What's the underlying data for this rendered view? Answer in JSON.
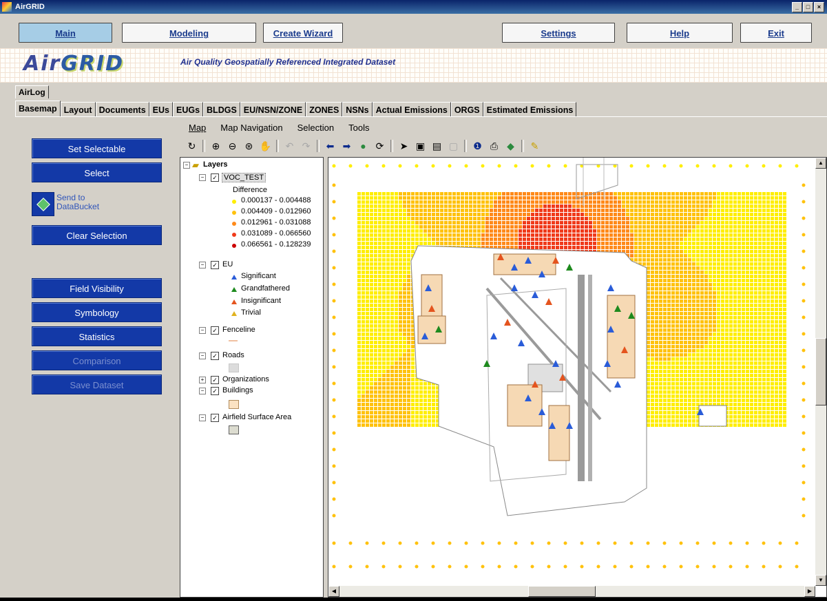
{
  "window": {
    "title": "AirGRID",
    "controls": [
      "_",
      "□",
      "×"
    ]
  },
  "nav": {
    "main": "Main",
    "modeling": "Modeling",
    "create_wizard": "Create Wizard",
    "settings": "Settings",
    "help": "Help",
    "exit": "Exit"
  },
  "banner": {
    "logo_part1": "Air",
    "logo_part2": "GRID",
    "subtitle": "Air Quality Geospatially Referenced Integrated Dataset"
  },
  "airlog_tab": "AirLog",
  "tabs": [
    "Basemap",
    "Layout",
    "Documents",
    "EUs",
    "EUGs",
    "BLDGS",
    "EU/NSN/ZONE",
    "ZONES",
    "NSNs",
    "Actual Emissions",
    "ORGS",
    "Estimated Emissions"
  ],
  "menu": {
    "map": "Map",
    "map_navigation": "Map Navigation",
    "selection": "Selection",
    "tools": "Tools"
  },
  "toolbar_icons": [
    "refresh-icon",
    "zoom-in-icon",
    "zoom-out-icon",
    "zoom-full-icon",
    "pan-icon",
    "back-icon",
    "forward-icon",
    "left-arrow-icon",
    "right-arrow-icon",
    "globe-icon",
    "reload-icon",
    "select-arrow-icon",
    "identify-icon",
    "layer-icon",
    "table-icon",
    "info-icon",
    "print-icon",
    "symbol-icon",
    "measure-icon"
  ],
  "left_buttons": {
    "set_selectable": "Set Selectable",
    "select": "Select",
    "send_to": "Send to",
    "databucket": "DataBucket",
    "clear_selection": "Clear Selection",
    "field_visibility": "Field Visibility",
    "symbology": "Symbology",
    "statistics": "Statistics",
    "comparison": "Comparison",
    "save_dataset": "Save Dataset"
  },
  "layers": {
    "root": "Layers",
    "voc": "VOC_TEST",
    "difference": "Difference",
    "ranges": [
      "0.000137 - 0.004488",
      "0.004409 - 0.012960",
      "0.012961 - 0.031088",
      "0.031089 - 0.066560",
      "0.066561 - 0.128239"
    ],
    "range_colors": [
      "#ffee00",
      "#ffc20e",
      "#ff8a1a",
      "#f03a1a",
      "#cc0000"
    ],
    "eu": "EU",
    "eu_items": [
      "Significant",
      "Grandfathered",
      "Insignificant",
      "Trivial"
    ],
    "eu_colors": [
      "#2a5cd8",
      "#1e8a1e",
      "#e4541e",
      "#e0b21e"
    ],
    "fenceline": "Fenceline",
    "roads": "Roads",
    "organizations": "Organizations",
    "buildings": "Buildings",
    "airfield": "Airfield Surface Area"
  },
  "map": {
    "colors": {
      "base": "#ffee00",
      "mid": "#ffc20e",
      "high": "#ff8a1a",
      "peak": "#f03a1a"
    }
  }
}
